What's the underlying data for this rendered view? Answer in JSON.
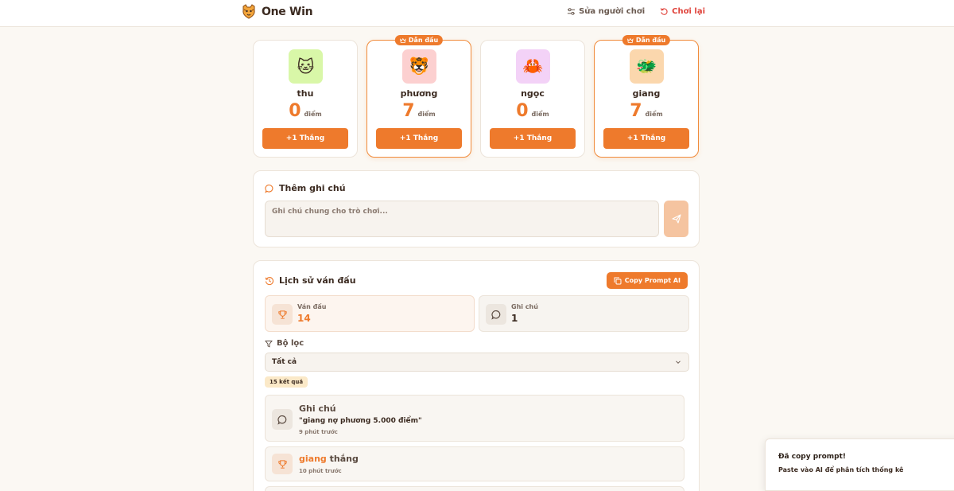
{
  "header": {
    "brand": "One Win",
    "edit_players_label": "Sửa người chơi",
    "reset_label": "Chơi lại"
  },
  "players": [
    {
      "name": "thu",
      "score": "0",
      "score_unit": "điểm",
      "win_label": "+1 Thắng",
      "avatar_emoji": "🐱",
      "avatar_bg": "#d9f7a8",
      "leader": false
    },
    {
      "name": "phương",
      "score": "7",
      "score_unit": "điểm",
      "win_label": "+1 Thắng",
      "avatar_emoji": "🐯",
      "avatar_bg": "#fcd0d0",
      "leader": true
    },
    {
      "name": "ngọc",
      "score": "0",
      "score_unit": "điểm",
      "win_label": "+1 Thắng",
      "avatar_emoji": "🦀",
      "avatar_bg": "#f3d2f7",
      "leader": false
    },
    {
      "name": "giang",
      "score": "7",
      "score_unit": "điểm",
      "win_label": "+1 Thắng",
      "avatar_emoji": "🐲",
      "avatar_bg": "#fbd7ad",
      "leader": true
    }
  ],
  "leader_badge": "Dẫn đầu",
  "note_panel": {
    "title": "Thêm ghi chú",
    "placeholder": "Ghi chú chung cho trò chơi..."
  },
  "history": {
    "title": "Lịch sử ván đấu",
    "copy_prompt_label": "Copy Prompt AI",
    "stats": {
      "games_label": "Ván đấu",
      "games_value": "14",
      "notes_label": "Ghi chú",
      "notes_value": "1"
    },
    "filter_label": "Bộ lọc",
    "filter_selected": "Tất cả",
    "result_count": "15 kết quả",
    "items": [
      {
        "type": "note",
        "title": "Ghi chú",
        "quote": "\"giang nợ phương 5.000 điểm\"",
        "time": "9 phút trước"
      },
      {
        "type": "win",
        "winner": "giang",
        "action": "thắng",
        "time": "10 phút trước"
      }
    ]
  },
  "toast": {
    "title": "Đã copy prompt!",
    "body": "Paste vào AI để phân tích thống kê"
  },
  "colors": {
    "accent": "#ee7a2c",
    "danger": "#e0443c",
    "background": "#fbf8f3"
  }
}
